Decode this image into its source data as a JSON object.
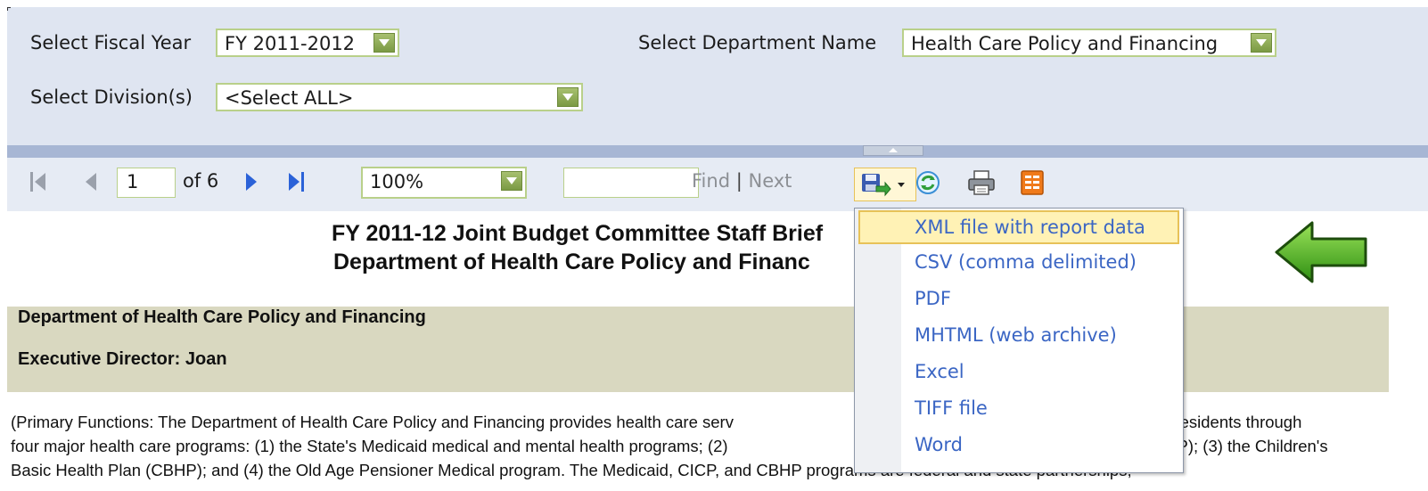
{
  "params": {
    "fiscal_year_label": "Select Fiscal Year",
    "fiscal_year_value": "FY 2011-2012",
    "department_label": "Select Department Name",
    "department_value": "Health Care Policy and Financing",
    "division_label": "Select Division(s)",
    "division_value": "<Select ALL>"
  },
  "toolbar": {
    "page_current": "1",
    "page_of": "of 6",
    "zoom_value": "100%",
    "find_label": "Find",
    "find_separator": "|",
    "next_label": "Next",
    "icons": [
      "first-page-icon",
      "previous-page-icon",
      "next-page-icon",
      "last-page-icon",
      "export-save-icon",
      "refresh-icon",
      "print-icon",
      "data-feed-icon"
    ]
  },
  "export_menu": {
    "items": [
      {
        "label": "XML file with report data",
        "highlighted": true
      },
      {
        "label": "CSV (comma delimited)"
      },
      {
        "label": "PDF"
      },
      {
        "label": "MHTML (web archive)"
      },
      {
        "label": "Excel"
      },
      {
        "label": "TIFF file"
      },
      {
        "label": "Word"
      }
    ]
  },
  "report": {
    "title_line1": "FY 2011-12 Joint Budget Committee Staff Brief",
    "title_line2": "Department of Health Care Policy and Financ",
    "band_line1": "Department of Health Care Policy and Financing",
    "band_line2": "Executive Director: Joan",
    "para_line1_left": "(Primary Functions: The Department of Health Care Policy and Financing provides health care serv",
    "para_line1_right": "o residents through",
    "para_line2_left": "four major health care programs: (1) the State's Medicaid medical and mental health programs; (2)",
    "para_line2_right": "ICP); (3) the Children's",
    "para_line3": "Basic Health Plan (CBHP); and (4) the Old Age Pensioner Medical program. The Medicaid, CICP, and CBHP programs are federal and state partnerships;"
  },
  "colors": {
    "param_panel": "#dfe5f1",
    "toolbar": "#e6ebf4",
    "splitter": "#a7b6d4",
    "menu_link": "#3b66c4",
    "menu_highlight": "#fff2b5",
    "band": "#d9d8c0",
    "arrow_green": "#4caf1e"
  }
}
